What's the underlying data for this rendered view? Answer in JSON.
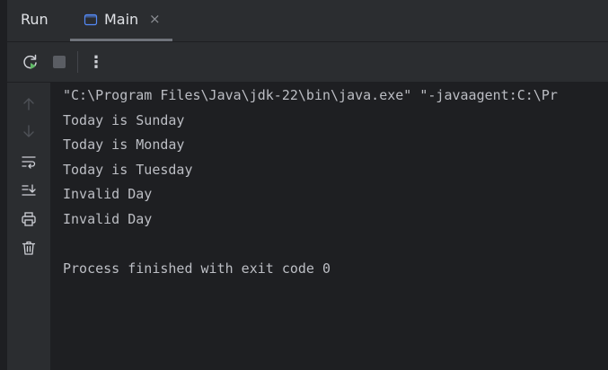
{
  "header": {
    "title": "Run",
    "tab": {
      "label": "Main",
      "close": "×"
    }
  },
  "toolbar": {
    "rerun_icon": "rerun-icon",
    "stop_icon": "stop-icon",
    "more_icon": "more-vertical-icon",
    "more_label": "⋮"
  },
  "gutter": {
    "icons": [
      "arrow-up-icon",
      "arrow-down-icon",
      "soft-wrap-icon",
      "scroll-to-end-icon",
      "print-icon",
      "trash-icon"
    ]
  },
  "console": {
    "lines": [
      "\"C:\\Program Files\\Java\\jdk-22\\bin\\java.exe\" \"-javaagent:C:\\Pr",
      "Today is Sunday",
      "Today is Monday",
      "Today is Tuesday",
      "Invalid Day",
      "Invalid Day",
      "",
      "Process finished with exit code 0"
    ]
  },
  "colors": {
    "background": "#2b2d30",
    "console_background": "#1e1f22",
    "text": "#bcbec4",
    "accent_green": "#5fb865"
  }
}
